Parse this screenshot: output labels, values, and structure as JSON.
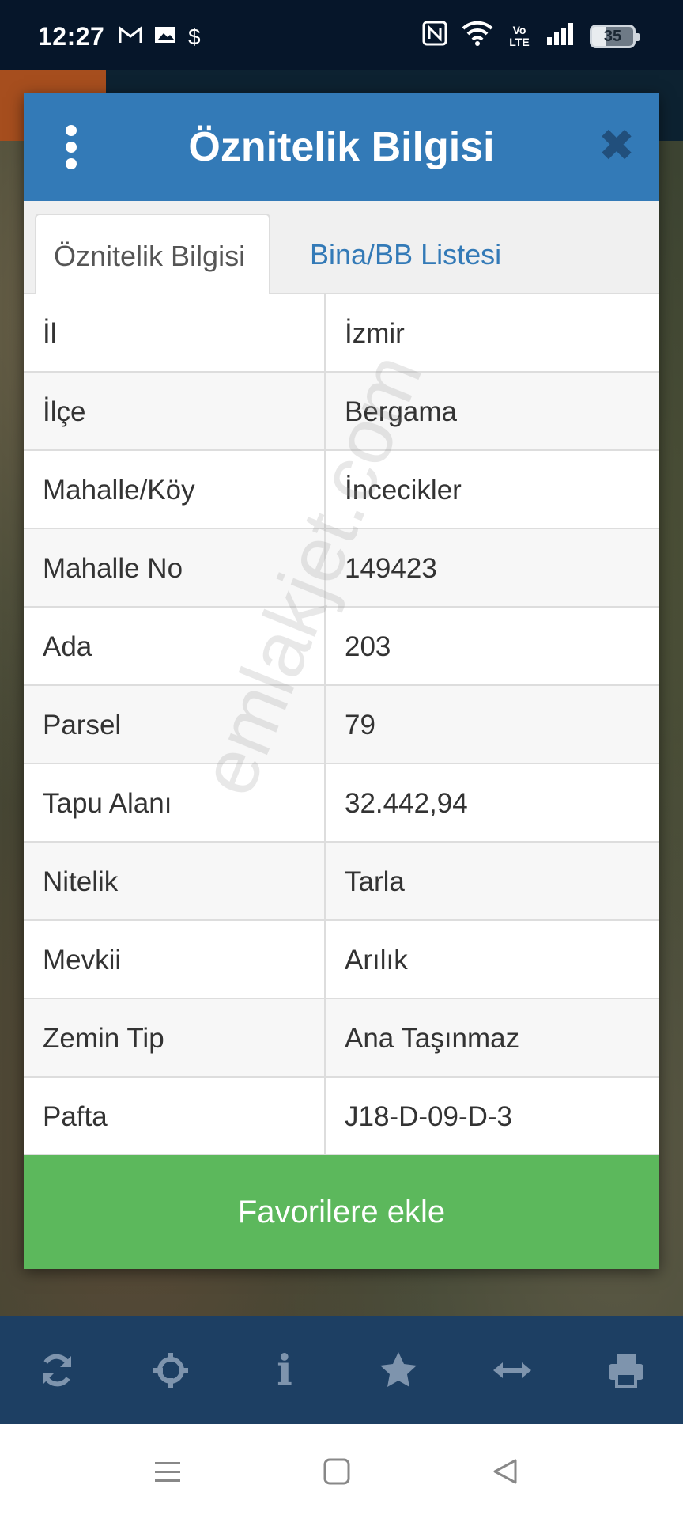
{
  "status_bar": {
    "time": "12:27",
    "battery_level": "35",
    "battery_fraction": 0.35,
    "network_label": "Vo LTE"
  },
  "modal": {
    "title": "Öznitelik Bilgisi",
    "close_label": "✖",
    "tabs": [
      {
        "label": "Öznitelik Bilgisi",
        "active": true
      },
      {
        "label": "Bina/BB Listesi",
        "active": false
      }
    ],
    "rows": [
      {
        "key": "İl",
        "value": "İzmir"
      },
      {
        "key": "İlçe",
        "value": "Bergama"
      },
      {
        "key": "Mahalle/Köy",
        "value": "İncecikler"
      },
      {
        "key": "Mahalle No",
        "value": "149423"
      },
      {
        "key": "Ada",
        "value": "203"
      },
      {
        "key": "Parsel",
        "value": "79"
      },
      {
        "key": "Tapu Alanı",
        "value": "32.442,94"
      },
      {
        "key": "Nitelik",
        "value": "Tarla"
      },
      {
        "key": "Mevkii",
        "value": "Arılık"
      },
      {
        "key": "Zemin Tip",
        "value": "Ana Taşınmaz"
      },
      {
        "key": "Pafta",
        "value": "J18-D-09-D-3"
      }
    ],
    "favorite_button": "Favorilere ekle"
  },
  "watermark": "emlakjet.com",
  "toolbar": {
    "icons": [
      "refresh-icon",
      "crosshair-icon",
      "info-icon",
      "star-icon",
      "arrows-horizontal-icon",
      "print-icon"
    ],
    "info_glyph": "i"
  },
  "colors": {
    "header_blue": "#337ab7",
    "favorite_green": "#5cb85c",
    "toolbar_navy": "#1d3f63"
  }
}
